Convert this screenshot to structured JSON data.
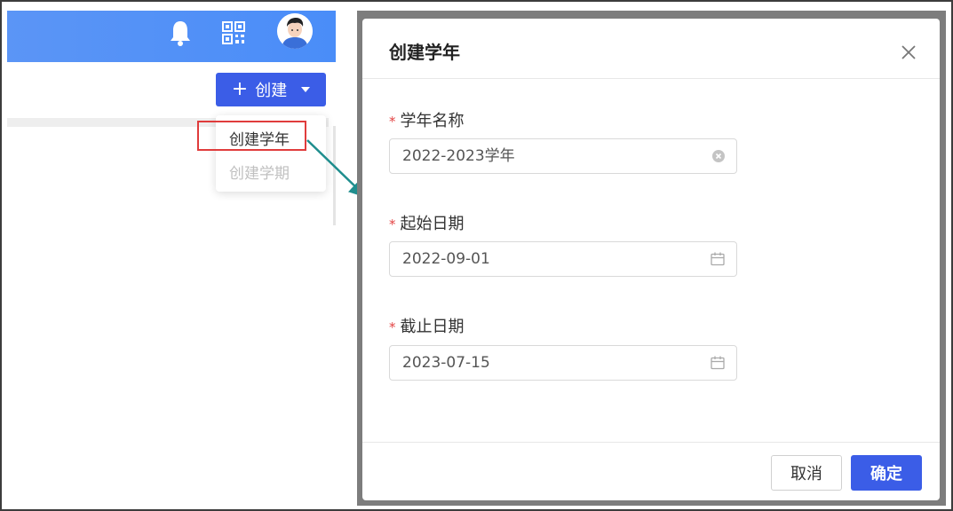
{
  "header": {
    "icons": [
      "bell-icon",
      "qr-code-icon",
      "avatar"
    ]
  },
  "toolbar": {
    "create_label": "创建",
    "create_icon": "plus-icon"
  },
  "dropdown": {
    "items": [
      {
        "label": "创建学年",
        "highlighted": true
      },
      {
        "label": "创建学期",
        "disabled": true
      }
    ]
  },
  "modal": {
    "title": "创建学年",
    "fields": [
      {
        "label": "学年名称",
        "required_mark": "*",
        "value": "2022-2023学年",
        "icon": "clear-icon"
      },
      {
        "label": "起始日期",
        "required_mark": "*",
        "value": "2022-09-01",
        "icon": "calendar-icon"
      },
      {
        "label": "截止日期",
        "required_mark": "*",
        "value": "2023-07-15",
        "icon": "calendar-icon"
      }
    ],
    "cancel_label": "取消",
    "ok_label": "确定"
  },
  "colors": {
    "header_bg": "#4a8df8",
    "primary": "#3b5de7",
    "required": "#e34444",
    "highlight_border": "#e03c3c",
    "arrow": "#1f8e8e",
    "backdrop": "#7d7d7d"
  }
}
